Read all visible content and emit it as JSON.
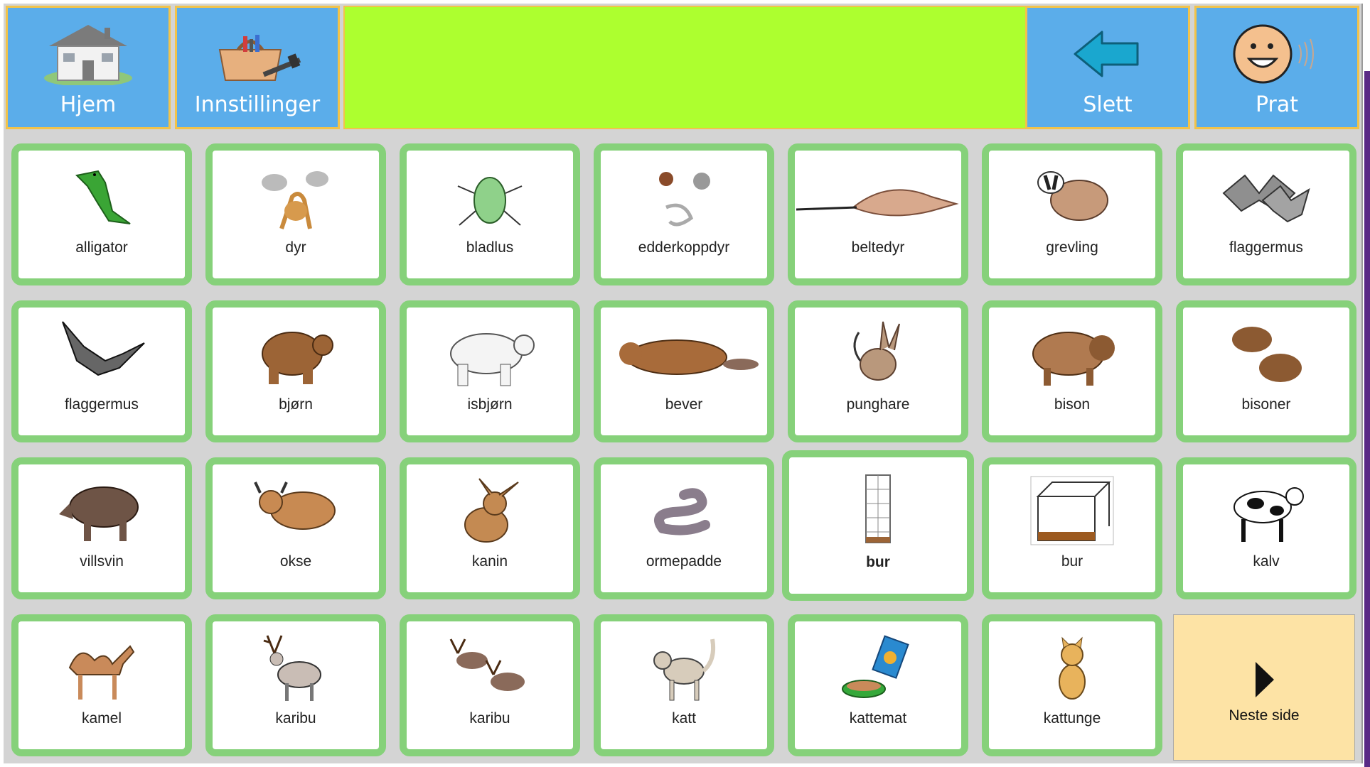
{
  "toolbar": {
    "home_label": "Hjem",
    "settings_label": "Innstillinger",
    "message_text": "",
    "delete_label": "Slett",
    "speak_label": "Prat"
  },
  "grid": {
    "items": [
      {
        "label": "alligator",
        "icon": "alligator-icon"
      },
      {
        "label": "dyr",
        "icon": "animals-icon"
      },
      {
        "label": "bladlus",
        "icon": "aphid-icon"
      },
      {
        "label": "edderkoppdyr",
        "icon": "arachnids-icon"
      },
      {
        "label": "beltedyr",
        "icon": "armadillo-icon"
      },
      {
        "label": "grevling",
        "icon": "badger-icon"
      },
      {
        "label": "flaggermus",
        "icon": "bats-icon"
      },
      {
        "label": "flaggermus",
        "icon": "bat-icon"
      },
      {
        "label": "bjørn",
        "icon": "bear-icon"
      },
      {
        "label": "isbjørn",
        "icon": "polar-bear-icon"
      },
      {
        "label": "bever",
        "icon": "beaver-icon"
      },
      {
        "label": "punghare",
        "icon": "bilby-icon"
      },
      {
        "label": "bison",
        "icon": "bison-icon"
      },
      {
        "label": "bisoner",
        "icon": "bisons-icon"
      },
      {
        "label": "villsvin",
        "icon": "wild-boar-icon"
      },
      {
        "label": "okse",
        "icon": "bull-icon"
      },
      {
        "label": "kanin",
        "icon": "rabbit-icon"
      },
      {
        "label": "ormepadde",
        "icon": "caecilian-icon"
      },
      {
        "label": "bur",
        "icon": "tall-cage-icon"
      },
      {
        "label": "bur",
        "icon": "cage-icon"
      },
      {
        "label": "kalv",
        "icon": "calf-icon"
      },
      {
        "label": "kamel",
        "icon": "camel-icon"
      },
      {
        "label": "karibu",
        "icon": "caribou-icon"
      },
      {
        "label": "karibu",
        "icon": "caribou-herd-icon"
      },
      {
        "label": "katt",
        "icon": "cat-icon"
      },
      {
        "label": "kattemat",
        "icon": "cat-food-icon"
      },
      {
        "label": "kattunge",
        "icon": "kitten-icon"
      }
    ],
    "next_label": "Neste side"
  },
  "colors": {
    "toolbar_button": "#5badea",
    "message_bar": "#adff2f",
    "cell_border": "#86d17a",
    "next_page": "#fde3a5",
    "highlight_border": "#f2c34a"
  }
}
